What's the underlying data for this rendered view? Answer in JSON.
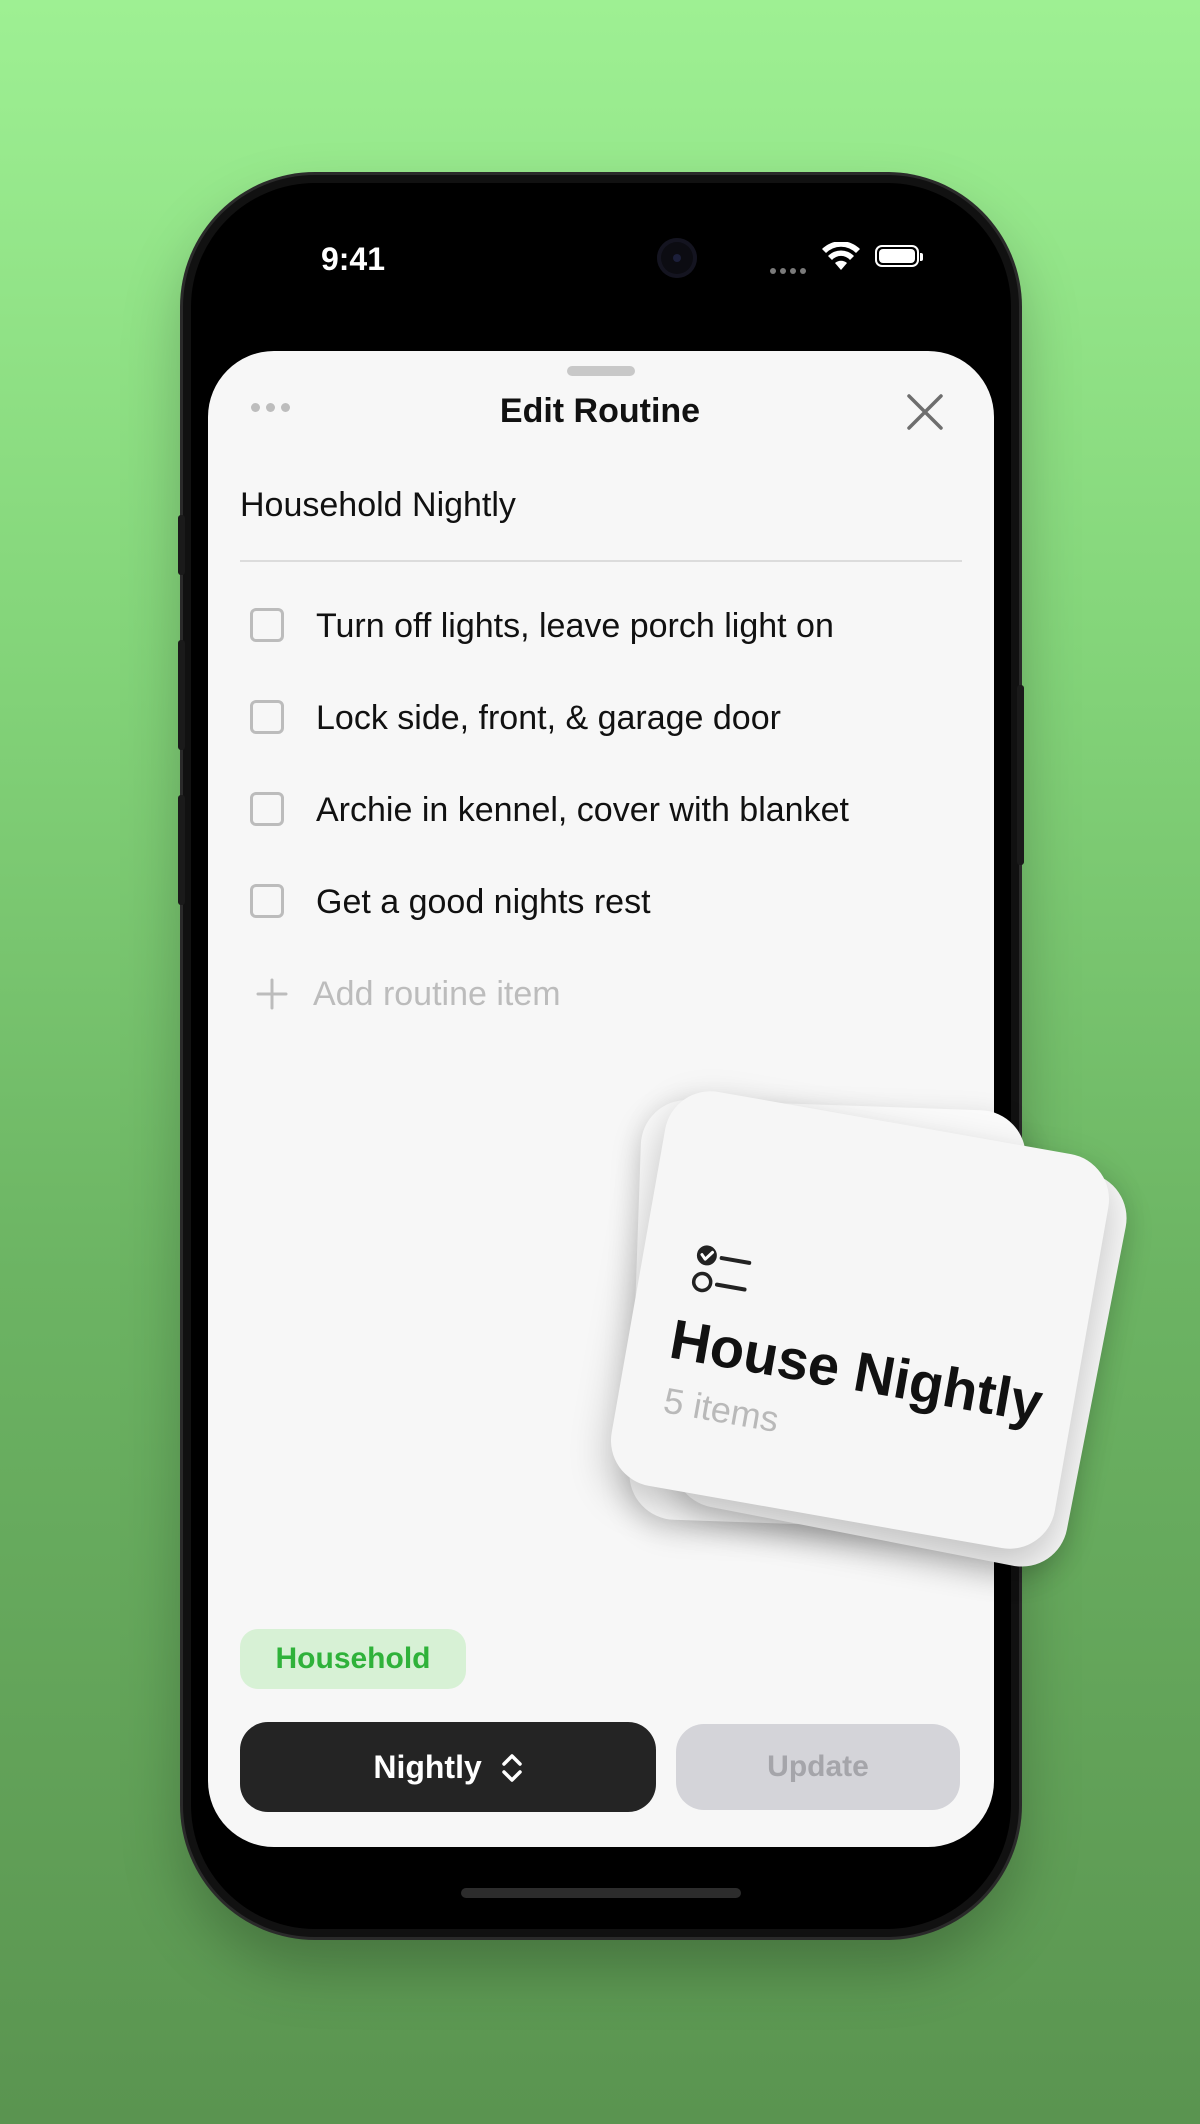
{
  "status_bar": {
    "time": "9:41"
  },
  "sheet": {
    "title": "Edit Routine",
    "routine_name": "Household Nightly",
    "items": [
      {
        "label": "Turn off lights, leave porch light on",
        "checked": false
      },
      {
        "label": "Lock side, front, & garage door",
        "checked": false
      },
      {
        "label": "Archie in kennel, cover with blanket",
        "checked": false
      },
      {
        "label": "Get a good nights rest",
        "checked": false
      }
    ],
    "add_item_label": "Add routine item",
    "tag_label": "Household",
    "frequency_label": "Nightly",
    "update_label": "Update"
  },
  "card": {
    "title": "House Nightly",
    "count": "5 items",
    "icon": "checklist-icon"
  },
  "colors": {
    "tag_text": "#2fb23a",
    "tag_bg": "#d7f1d5",
    "primary_button": "#242424",
    "disabled_button": "#d4d4d9"
  }
}
